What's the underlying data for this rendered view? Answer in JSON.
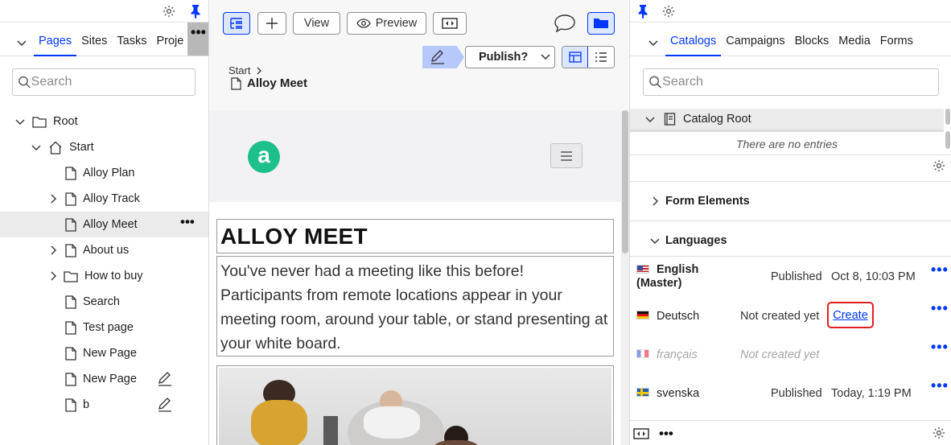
{
  "left": {
    "tabs": [
      "Pages",
      "Sites",
      "Tasks",
      "Proje"
    ],
    "search_placeholder": "Search",
    "tree": [
      {
        "label": "Root",
        "type": "folder",
        "level": 0,
        "expanded": true
      },
      {
        "label": "Start",
        "type": "home",
        "level": 1,
        "expanded": true
      },
      {
        "label": "Alloy Plan",
        "type": "page",
        "level": 2
      },
      {
        "label": "Alloy Track",
        "type": "page",
        "level": 2,
        "collapsed": true
      },
      {
        "label": "Alloy Meet",
        "type": "page",
        "level": 2,
        "selected": true
      },
      {
        "label": "About us",
        "type": "page",
        "level": 2,
        "collapsed": true
      },
      {
        "label": "How to buy",
        "type": "folder",
        "level": 2,
        "collapsed": true
      },
      {
        "label": "Search",
        "type": "page",
        "level": 2
      },
      {
        "label": "Test page",
        "type": "page",
        "level": 2
      },
      {
        "label": "New Page",
        "type": "page",
        "level": 2
      },
      {
        "label": "New Page",
        "type": "page",
        "level": 2,
        "editing": true
      },
      {
        "label": "b",
        "type": "page",
        "level": 2,
        "editing": true
      }
    ]
  },
  "center": {
    "toolbar": {
      "view_label": "View",
      "preview_label": "Preview",
      "publish_label": "Publish?"
    },
    "breadcrumb": {
      "parent": "Start",
      "current": "Alloy Meet"
    },
    "page": {
      "logo_letter": "a",
      "heading": "ALLOY MEET",
      "intro": "You've never had a meeting like this before! Participants from remote locations appear in your meeting room, around your table, or stand presenting at your white board."
    }
  },
  "right": {
    "tabs": [
      "Catalogs",
      "Campaigns",
      "Blocks",
      "Media",
      "Forms"
    ],
    "search_placeholder": "Search",
    "catalog_root": "Catalog Root",
    "no_entries": "There are no entries",
    "form_elements": "Form Elements",
    "languages_title": "Languages",
    "languages": [
      {
        "name": "English",
        "sub": "(Master)",
        "status": "Published",
        "date": "Oct 8, 10:03 PM",
        "flag": "us",
        "bold": true
      },
      {
        "name": "Deutsch",
        "status": "Not created yet",
        "action": "Create",
        "flag": "de"
      },
      {
        "name": "français",
        "status": "Not created yet",
        "flag": "fr",
        "disabled": true
      },
      {
        "name": "svenska",
        "status": "Published",
        "date": "Today, 1:19 PM",
        "flag": "se"
      }
    ]
  },
  "colors": {
    "accent": "#0037ff",
    "logo": "#1dbf8d",
    "highlight": "#e02020"
  }
}
